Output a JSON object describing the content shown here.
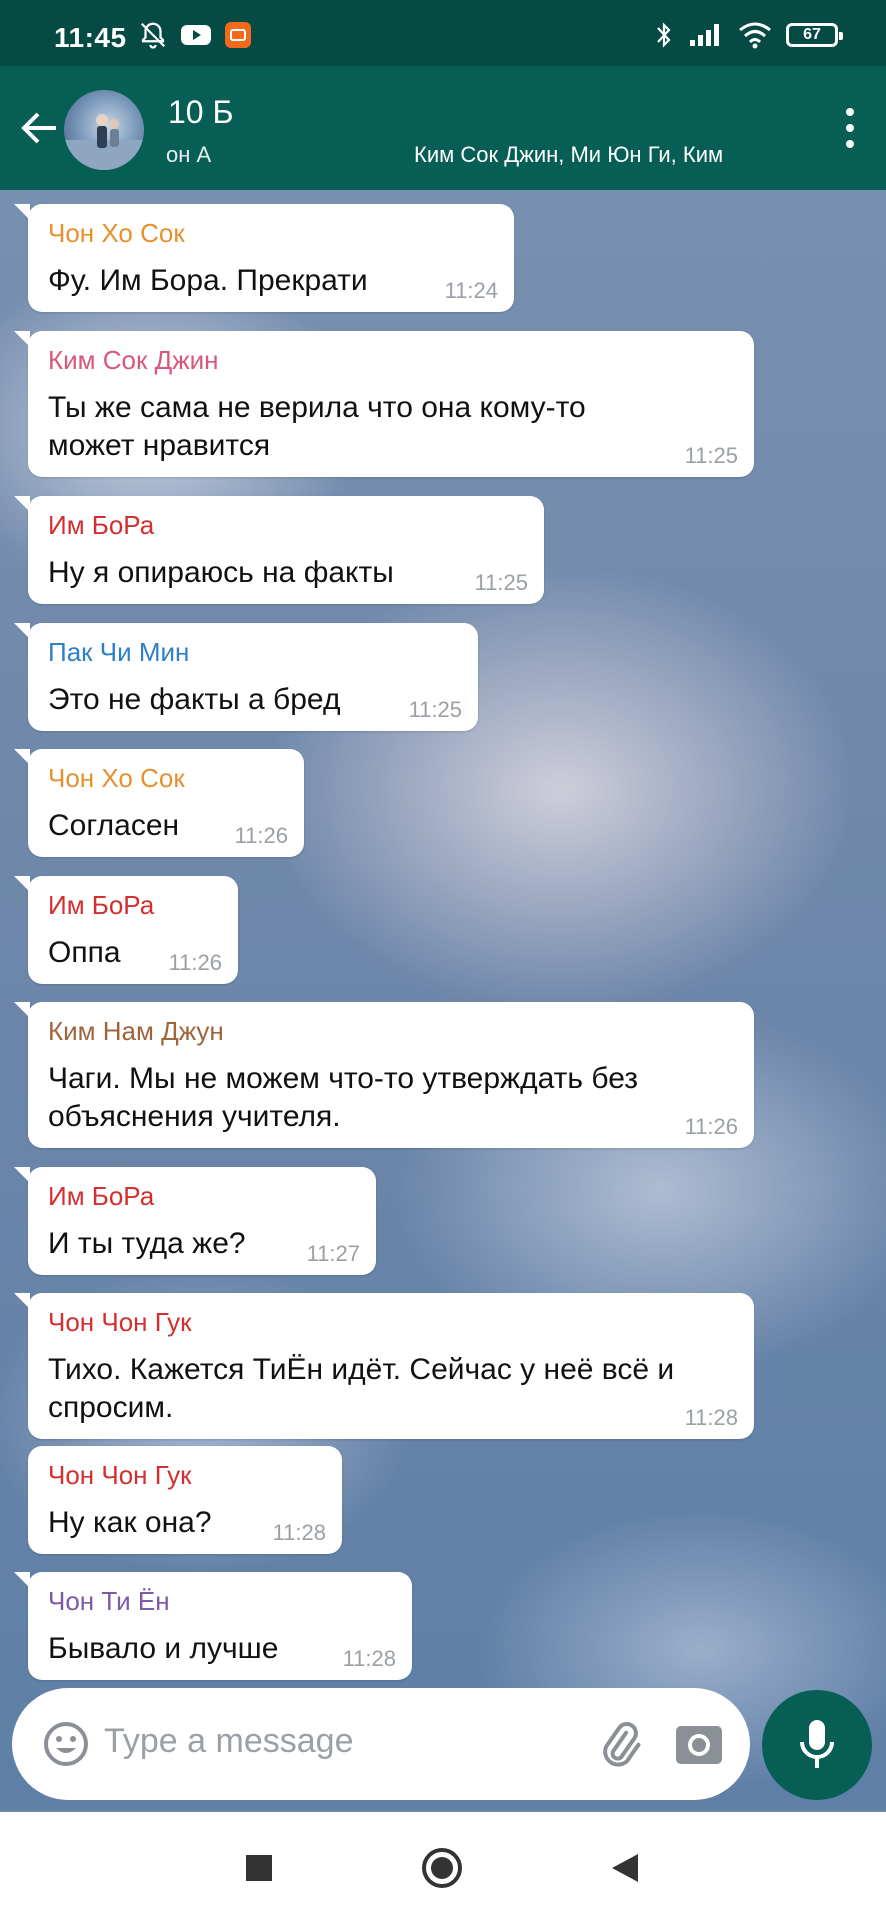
{
  "status_bar": {
    "time": "11:45",
    "battery": "67",
    "icons": [
      "mute-icon",
      "youtube-icon",
      "mi-app-icon",
      "bluetooth-icon",
      "signal-icon",
      "wifi-icon",
      "battery-icon"
    ]
  },
  "header": {
    "title": "10 Б",
    "subtitle_left": "он А",
    "subtitle_right": "Ким Сок Джин, Ми Юн Ги, Ким",
    "icons": [
      "back-arrow-icon",
      "group-avatar",
      "more-vert-icon"
    ],
    "color": "#075e54"
  },
  "messages": [
    {
      "sender": "Чон Хо Сок",
      "sender_color": "#e8902e",
      "text_lines": [
        "Фу. Им Бора. Прекрати"
      ],
      "time": "11:24"
    },
    {
      "sender": "Ким Сок Джин",
      "sender_color": "#d9577d",
      "text_lines": [
        "Ты же сама не верила что она кому-то",
        "может нравится"
      ],
      "time": "11:25"
    },
    {
      "sender": "Им БоРа",
      "sender_color": "#d32f2f",
      "text_lines": [
        "Ну я опираюсь на факты"
      ],
      "time": "11:25"
    },
    {
      "sender": "Пак Чи Мин",
      "sender_color": "#2f7fc9",
      "text_lines": [
        "Это не факты а бред"
      ],
      "time": "11:25"
    },
    {
      "sender": "Чон Хо Сок",
      "sender_color": "#e8902e",
      "text_lines": [
        "Согласен"
      ],
      "time": "11:26"
    },
    {
      "sender": "Им БоРа",
      "sender_color": "#d32f2f",
      "text_lines": [
        "Оппа"
      ],
      "time": "11:26"
    },
    {
      "sender": "Ким Нам Джун",
      "sender_color": "#a0643c",
      "text_lines": [
        "Чаги. Мы не можем что-то утверждать без",
        "объяснения учителя."
      ],
      "time": "11:26"
    },
    {
      "sender": "Им БоРа",
      "sender_color": "#d32f2f",
      "text_lines": [
        "И ты туда же?"
      ],
      "time": "11:27"
    },
    {
      "sender": "Чон Чон Гук",
      "sender_color": "#d32f2f",
      "text_lines": [
        "Тихо. Кажется ТиЁн идёт. Сейчас у неё всё и",
        "спросим."
      ],
      "time": "11:28"
    },
    {
      "sender": "Чон Чон Гук",
      "sender_color": "#d32f2f",
      "text_lines": [
        "Ну как она?"
      ],
      "time": "11:28"
    },
    {
      "sender": "Чон Ти Ён",
      "sender_color": "#7b5aa6",
      "text_lines": [
        "Бывало и лучше"
      ],
      "time": "11:28"
    }
  ],
  "composer": {
    "placeholder": "Type a message",
    "icons": [
      "emoji-icon",
      "attach-icon",
      "camera-icon",
      "mic-icon"
    ]
  },
  "nav_bar": {
    "icons": [
      "recents-square-icon",
      "home-circle-icon",
      "back-triangle-icon"
    ]
  }
}
